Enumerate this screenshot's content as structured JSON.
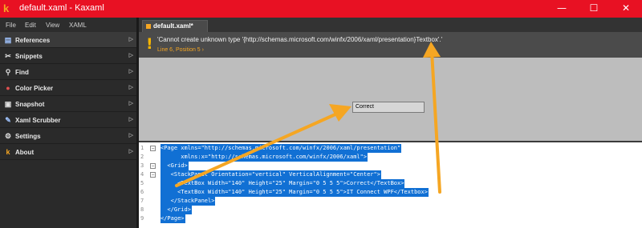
{
  "window": {
    "title": "default.xaml - Kaxaml",
    "logo_glyph": "k",
    "minimize_glyph": "—",
    "maximize_glyph": "☐",
    "close_glyph": "✕"
  },
  "menu": {
    "file": "File",
    "edit": "Edit",
    "view": "View",
    "xaml": "XAML"
  },
  "sidebar": {
    "items": [
      {
        "label": "References",
        "icon": "references-icon",
        "glyph": "▤",
        "color": "#a0c4ff"
      },
      {
        "label": "Snippets",
        "icon": "snippets-icon",
        "glyph": "✂",
        "color": "#e0e0e0"
      },
      {
        "label": "Find",
        "icon": "find-icon",
        "glyph": "⚲",
        "color": "#e0e0e0"
      },
      {
        "label": "Color Picker",
        "icon": "color-picker-icon",
        "glyph": "●",
        "color": "#e05050"
      },
      {
        "label": "Snapshot",
        "icon": "snapshot-icon",
        "glyph": "▣",
        "color": "#e0e0e0"
      },
      {
        "label": "Xaml Scrubber",
        "icon": "xaml-scrubber-icon",
        "glyph": "✎",
        "color": "#a0c4ff"
      },
      {
        "label": "Settings",
        "icon": "settings-icon",
        "glyph": "⚙",
        "color": "#e0e0e0"
      },
      {
        "label": "About",
        "icon": "kaxaml-logo-icon",
        "glyph": "k",
        "color": "#f5a623"
      }
    ],
    "arrow_glyph": "▷"
  },
  "tab": {
    "label": "default.xaml*"
  },
  "error": {
    "message": "'Cannot create unknown type '{http://schemas.microsoft.com/winfx/2006/xaml/presentation}Textbox'.'",
    "location": "Line 6, Position 5",
    "location_arrow": "›",
    "bang": "!"
  },
  "preview": {
    "textbox1_value": "Correct",
    "textbox2_value": ""
  },
  "code": {
    "lines": [
      {
        "num": "1",
        "text": "<Page xmlns=\"http://schemas.microsoft.com/winfx/2006/xaml/presentation\""
      },
      {
        "num": "2",
        "text": "      xmlns:x=\"http://schemas.microsoft.com/winfx/2006/xaml\">"
      },
      {
        "num": "3",
        "text": "  <Grid>"
      },
      {
        "num": "4",
        "text": "   <StackPanel Orientation=\"vertical\" VerticalAlignment=\"Center\">"
      },
      {
        "num": "5",
        "text": "     <TextBox Width=\"140\" Height=\"25\" Margin=\"0 5 5 5\">Correct</TextBox>"
      },
      {
        "num": "6",
        "text": "     <TextBox Width=\"140\" Height=\"25\" Margin=\"0 5 5 5\">IT Connect WPF</Textbox>"
      },
      {
        "num": "7",
        "text": "   </StackPanel>"
      },
      {
        "num": "8",
        "text": "  </Grid>"
      },
      {
        "num": "9",
        "text": "</Page>"
      }
    ]
  },
  "colors": {
    "accent": "#f5a623",
    "titlebar": "#e81123",
    "selection": "#1170d4"
  }
}
